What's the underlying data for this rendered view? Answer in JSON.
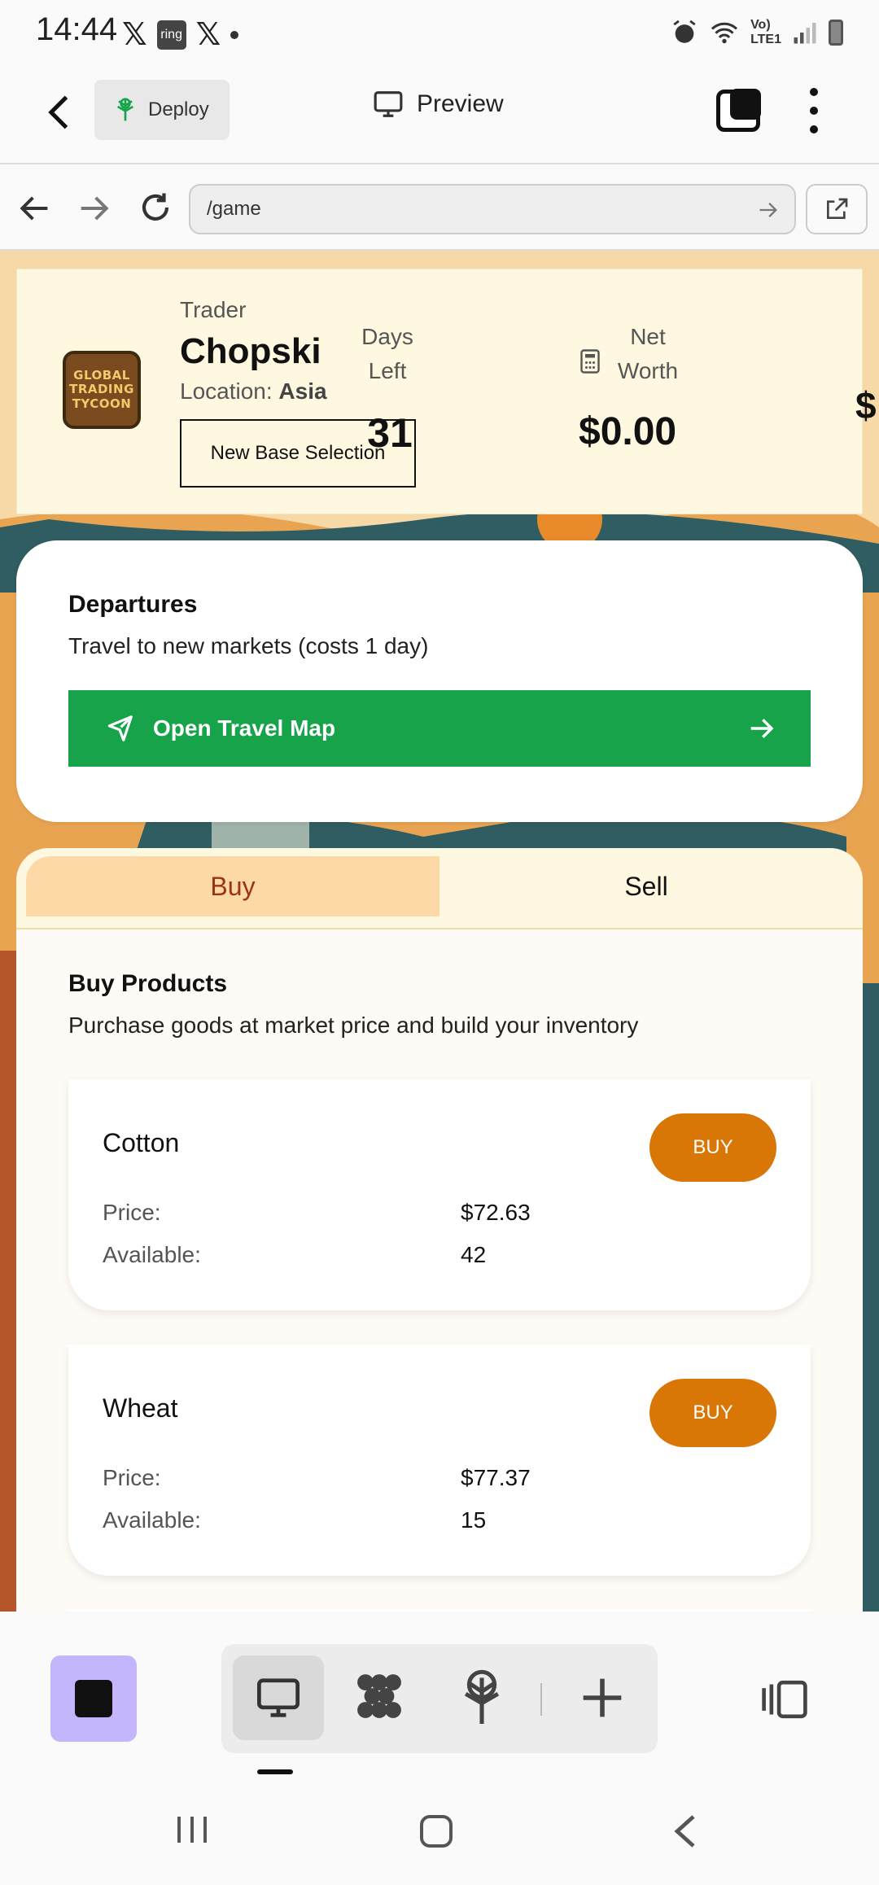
{
  "status_bar": {
    "time": "14:44",
    "left_icons": [
      "x-icon",
      "ring-icon",
      "x-icon",
      "dot-icon"
    ],
    "ring_text": "ring",
    "right_icons": [
      "alarm-icon",
      "wifi-icon",
      "volte-icon",
      "signal-icon",
      "battery-icon"
    ],
    "network_label_1": "Vo)",
    "network_label_2": "LTE1"
  },
  "toolbar": {
    "deploy_label": "Deploy",
    "preview_label": "Preview"
  },
  "url_bar": {
    "url": "/game"
  },
  "header": {
    "logo_lines": [
      "GLOBAL",
      "TRADING",
      "TYCOON"
    ],
    "trader_label": "Trader",
    "trader_name": "Chopski",
    "location_label": "Location:",
    "location_value": "Asia",
    "new_base_label": "New Base Selection",
    "days_label_1": "Days",
    "days_label_2": "Left",
    "days_value": "31",
    "net_worth_label_1": "Net",
    "net_worth_label_2": "Worth",
    "net_worth_value": "$0.00",
    "cut_value": "$"
  },
  "departures": {
    "title": "Departures",
    "subtitle": "Travel to new markets (costs 1 day)",
    "button_label": "Open Travel Map"
  },
  "trade": {
    "tabs": [
      {
        "label": "Buy",
        "active": true
      },
      {
        "label": "Sell",
        "active": false
      }
    ],
    "section_title": "Buy Products",
    "section_subtitle": "Purchase goods at market price and build your inventory",
    "price_label": "Price:",
    "available_label": "Available:",
    "buy_label": "BUY",
    "products": [
      {
        "name": "Cotton",
        "price": "$72.63",
        "available": "42"
      },
      {
        "name": "Wheat",
        "price": "$77.37",
        "available": "15"
      }
    ]
  },
  "colors": {
    "accent_green": "#16a34a",
    "buy_orange": "#d97706",
    "tab_active_bg": "#fdd9a8",
    "header_bg": "#fff8e1",
    "page_bg": "#fbe3c0"
  }
}
